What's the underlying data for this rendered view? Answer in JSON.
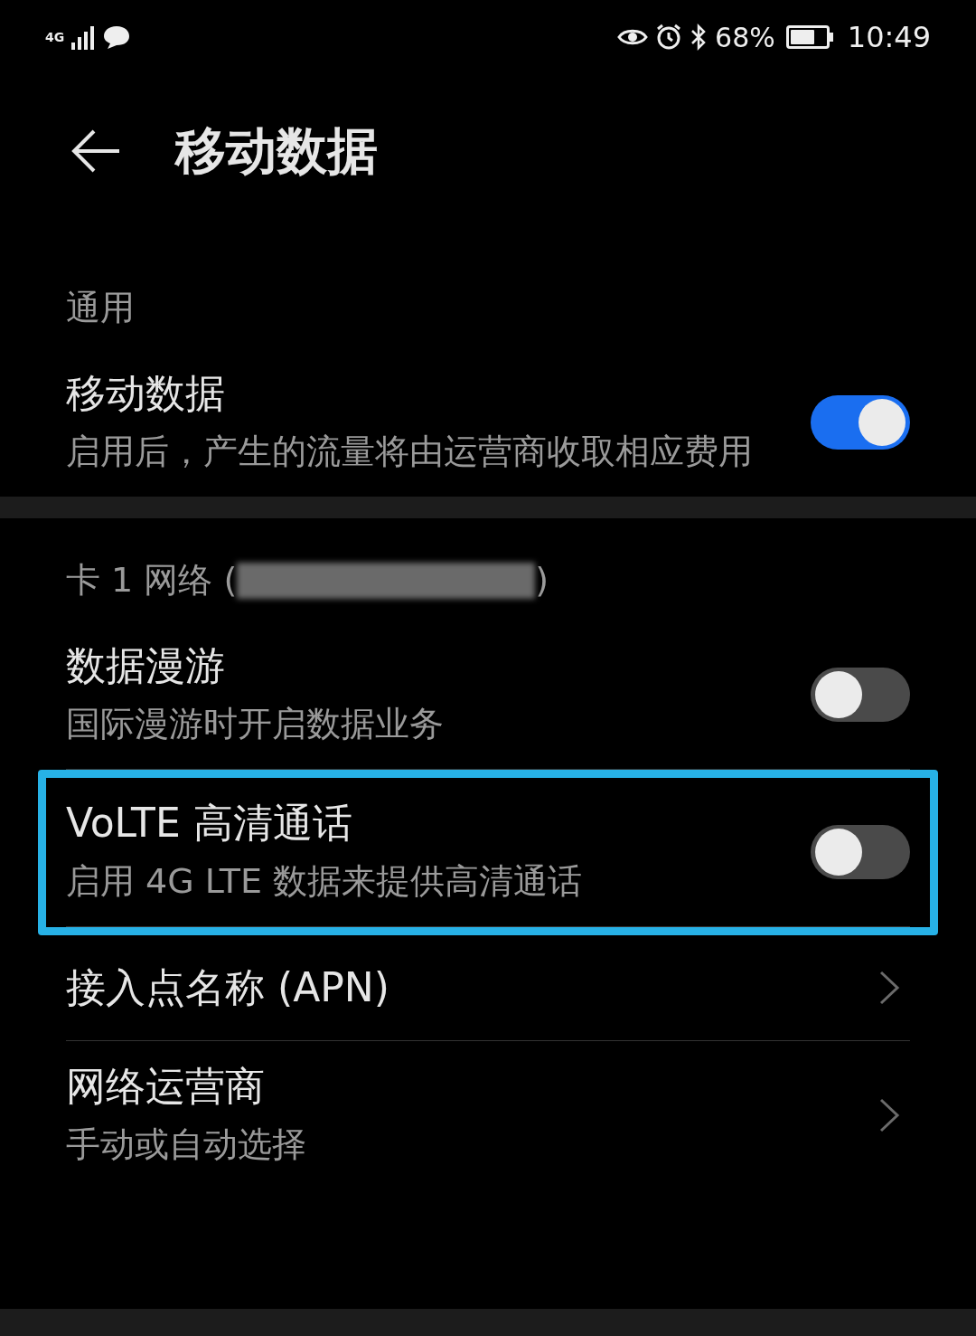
{
  "status_bar": {
    "network": "4G",
    "battery_text": "68%",
    "time": "10:49"
  },
  "header": {
    "title": "移动数据"
  },
  "sections": [
    {
      "header": {
        "text": "通用"
      },
      "items": [
        {
          "kind": "switch",
          "title": "移动数据",
          "subtitle": "启用后，产生的流量将由运营商收取相应费用",
          "on": true,
          "highlighted": false
        }
      ]
    },
    {
      "header": {
        "text": "卡 1 网络 (",
        "suffix": ")",
        "redacted": true
      },
      "items": [
        {
          "kind": "switch",
          "title": "数据漫游",
          "subtitle": "国际漫游时开启数据业务",
          "on": false,
          "highlighted": false
        },
        {
          "kind": "switch",
          "title": "VoLTE 高清通话",
          "subtitle": "启用 4G LTE 数据来提供高清通话",
          "on": false,
          "highlighted": true
        },
        {
          "kind": "link",
          "title": "接入点名称 (APN)",
          "highlighted": false
        },
        {
          "kind": "link",
          "title": "网络运营商",
          "subtitle": "手动或自动选择",
          "highlighted": false
        }
      ]
    }
  ]
}
